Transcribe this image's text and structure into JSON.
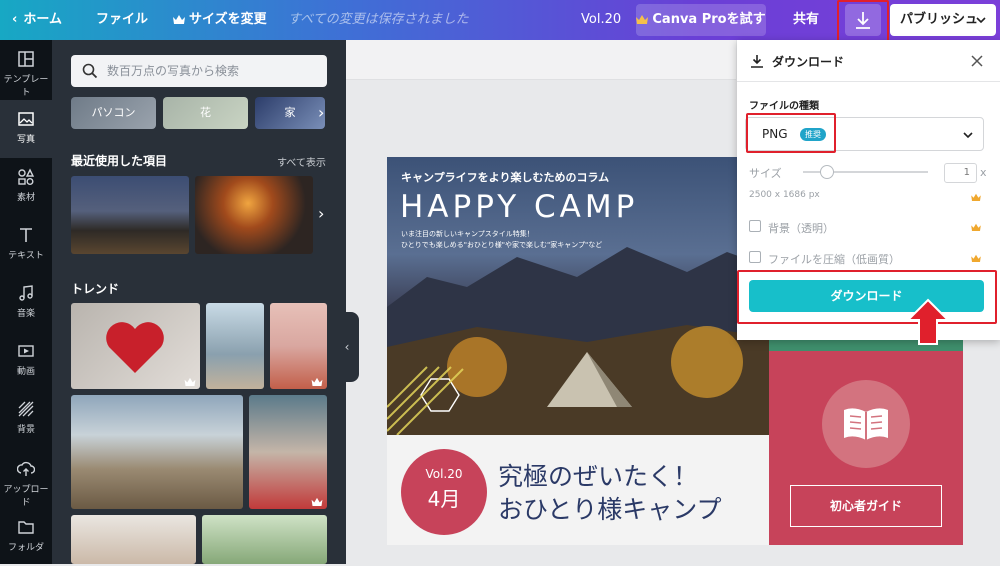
{
  "topbar": {
    "home": "ホーム",
    "file": "ファイル",
    "resize": "サイズを変更",
    "saved": "すべての変更は保存されました",
    "volume": "Vol.20",
    "pro_button": "Canva Proを試す",
    "share": "共有",
    "publish": "パブリッシュ"
  },
  "sidebar": {
    "items": [
      {
        "label": "テンプレート",
        "icon": "template-icon"
      },
      {
        "label": "写真",
        "icon": "photo-icon"
      },
      {
        "label": "素材",
        "icon": "elements-icon"
      },
      {
        "label": "テキスト",
        "icon": "text-icon"
      },
      {
        "label": "音楽",
        "icon": "music-icon"
      },
      {
        "label": "動画",
        "icon": "video-icon"
      },
      {
        "label": "背景",
        "icon": "background-icon"
      },
      {
        "label": "アップロード",
        "icon": "upload-icon"
      },
      {
        "label": "フォルダ",
        "icon": "folder-icon"
      }
    ]
  },
  "panel": {
    "search_placeholder": "数百万点の写真から検索",
    "chips": [
      "パソコン",
      "花",
      "家"
    ],
    "recent_title": "最近使用した項目",
    "see_all": "すべて表示",
    "trend_title": "トレンド"
  },
  "design": {
    "headline_small": "キャンプライフをより楽しむためのコラム",
    "headline_big": "HAPPY CAMP",
    "sub_line1": "いま注目の新しいキャンプスタイル特集！",
    "sub_line2": "ひとりでも楽しめる\"おひとり様\"や家で楽しむ\"家キャンプ\"など",
    "vol": "Vol.20",
    "month": "4月",
    "title_line1": "究極のぜいたく！",
    "title_line2": "おひとり様キャンプ",
    "guide_button": "初心者ガイド"
  },
  "download_panel": {
    "title": "ダウンロード",
    "file_type_label": "ファイルの種類",
    "file_type_value": "PNG",
    "recommended_badge": "推奨",
    "size_label": "サイズ",
    "size_value": "1",
    "size_suffix": "x",
    "dimensions": "2500 x 1686 px",
    "transparent_bg": "背景（透明）",
    "compress": "ファイルを圧縮（低画質）",
    "download_button": "ダウンロード"
  },
  "colors": {
    "highlight_red": "#e0202c",
    "accent_teal": "#17bfca",
    "design_pink": "#c7435a",
    "design_navy": "#2b3a67"
  }
}
